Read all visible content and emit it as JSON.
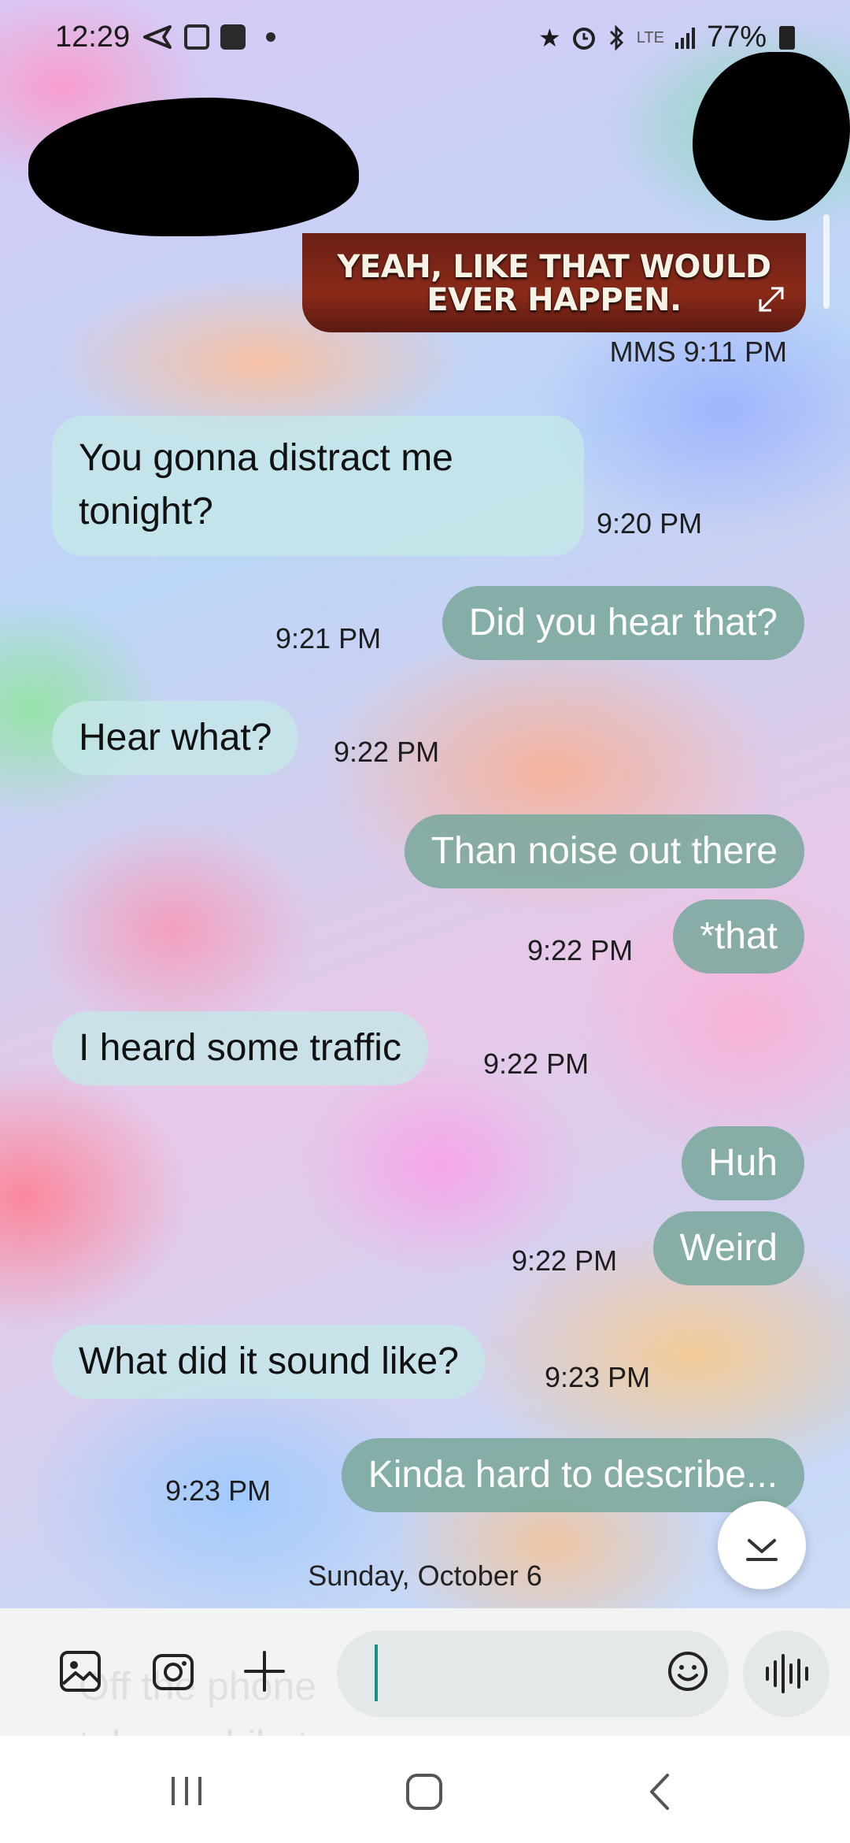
{
  "status_bar": {
    "time": "12:29",
    "network": "LTE",
    "battery": "77%"
  },
  "mms": {
    "caption": "YEAH, LIKE THAT WOULD EVER HAPPEN.",
    "meta": "MMS 9:11 PM"
  },
  "messages": [
    {
      "direction": "in",
      "text": "You gonna distract me tonight?",
      "time": "9:20 PM"
    },
    {
      "direction": "out",
      "text": "Did you hear that?",
      "time": "9:21 PM"
    },
    {
      "direction": "in",
      "text": "Hear what?",
      "time": "9:22 PM"
    },
    {
      "direction": "out",
      "text": "Than noise out there",
      "time": ""
    },
    {
      "direction": "out",
      "text": "*that",
      "time": "9:22 PM"
    },
    {
      "direction": "in",
      "text": "I heard some traffic",
      "time": "9:22 PM"
    },
    {
      "direction": "out",
      "text": "Huh",
      "time": ""
    },
    {
      "direction": "out",
      "text": "Weird",
      "time": "9:22 PM"
    },
    {
      "direction": "in",
      "text": "What did it sound like?",
      "time": "9:23 PM"
    },
    {
      "direction": "out",
      "text": "Kinda hard to describe...",
      "time": "9:23 PM"
    }
  ],
  "date_separator": "Sunday, October 6",
  "composer": {
    "ghost_text": "Off the phone\ntake a while to process"
  },
  "colors": {
    "incoming_bubble": "#c4e7e7",
    "outgoing_bubble": "#7daaa0",
    "cursor": "#1a8f84",
    "composer_bg": "#f2f4f4"
  },
  "icons": {
    "status_left": [
      "send-icon",
      "gallery-icon",
      "app-icon",
      "dot-icon"
    ],
    "status_right": [
      "star-icon",
      "alarm-icon",
      "bluetooth-icon",
      "lte-icon",
      "signal-icon",
      "battery-icon"
    ],
    "composer": [
      "gallery-icon",
      "camera-icon",
      "plus-icon",
      "emoji-icon",
      "voice-icon"
    ],
    "nav": [
      "recents-icon",
      "home-icon",
      "back-icon"
    ]
  }
}
